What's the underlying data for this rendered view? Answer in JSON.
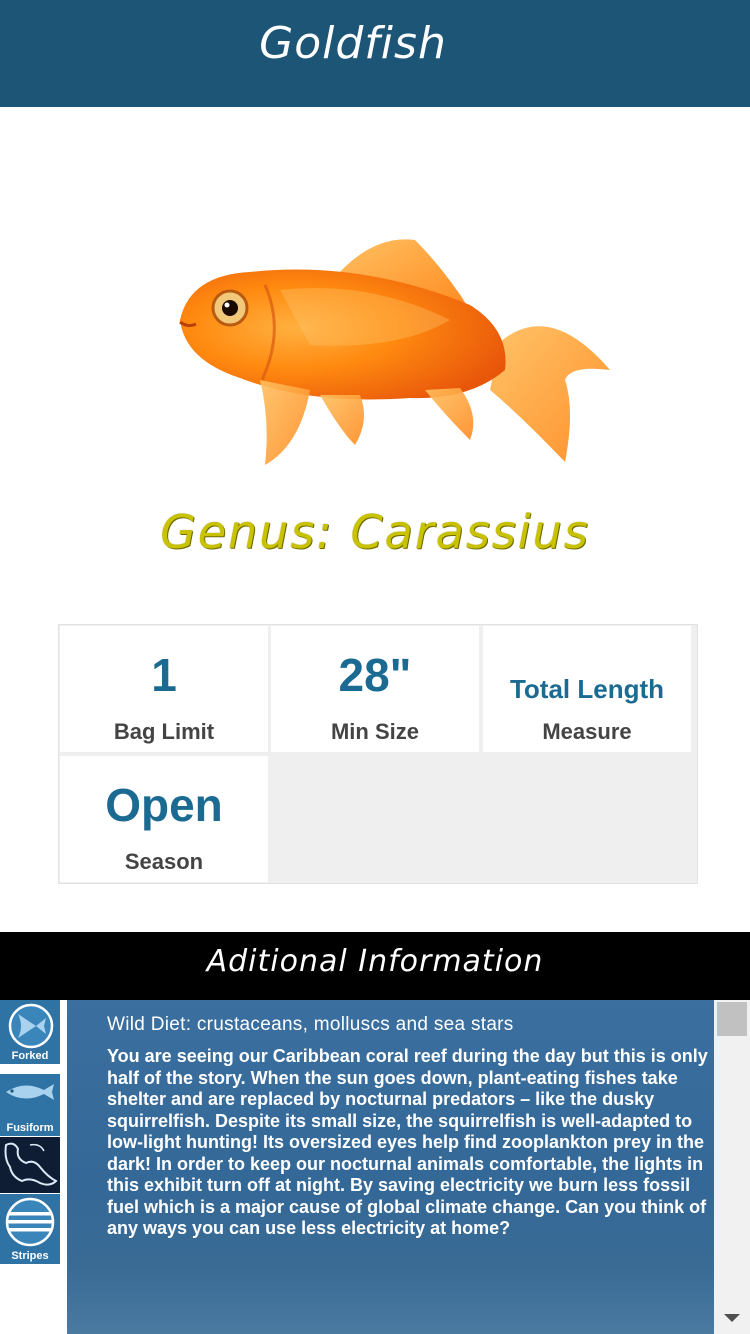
{
  "header": {
    "title": "Goldfish"
  },
  "species": {
    "genus_text": "Genus:  Carassius"
  },
  "stats": {
    "bag_limit": {
      "value": "1",
      "label": "Bag Limit"
    },
    "min_size": {
      "value": "28\"",
      "label": "Min Size"
    },
    "measure": {
      "value": "Total Length",
      "label": "Measure"
    },
    "season": {
      "value": "Open",
      "label": "Season"
    }
  },
  "additional": {
    "title": "Aditional Information",
    "heading": "Wild Diet: crustaceans, molluscs and sea stars",
    "body": "You are seeing our Caribbean coral reef during the day but this is only half of the story. When the sun goes down, plant-eating fishes take shelter and are replaced by nocturnal predators – like the dusky squirrelfish. Despite its small size, the squirrelfish is well-adapted to low-light hunting! Its oversized eyes help find zooplankton prey in the dark! In order to keep our nocturnal animals comfortable, the lights in this exhibit turn off at night. By saving electricity we burn less fossil fuel which is a major cause of global climate change. Can you think of any ways you can use less electricity at home?"
  },
  "sidebar": {
    "items": [
      {
        "label": "Forked",
        "icon": "forked-tail-icon"
      },
      {
        "label": "Fusiform",
        "icon": "fusiform-fish-icon"
      },
      {
        "label": "",
        "icon": "region-map-icon"
      },
      {
        "label": "Stripes",
        "icon": "stripes-icon"
      }
    ]
  },
  "colors": {
    "header": "#1d5577",
    "accent_value": "#1b6a92",
    "genus": "#c9c200",
    "panel": "#346897"
  }
}
